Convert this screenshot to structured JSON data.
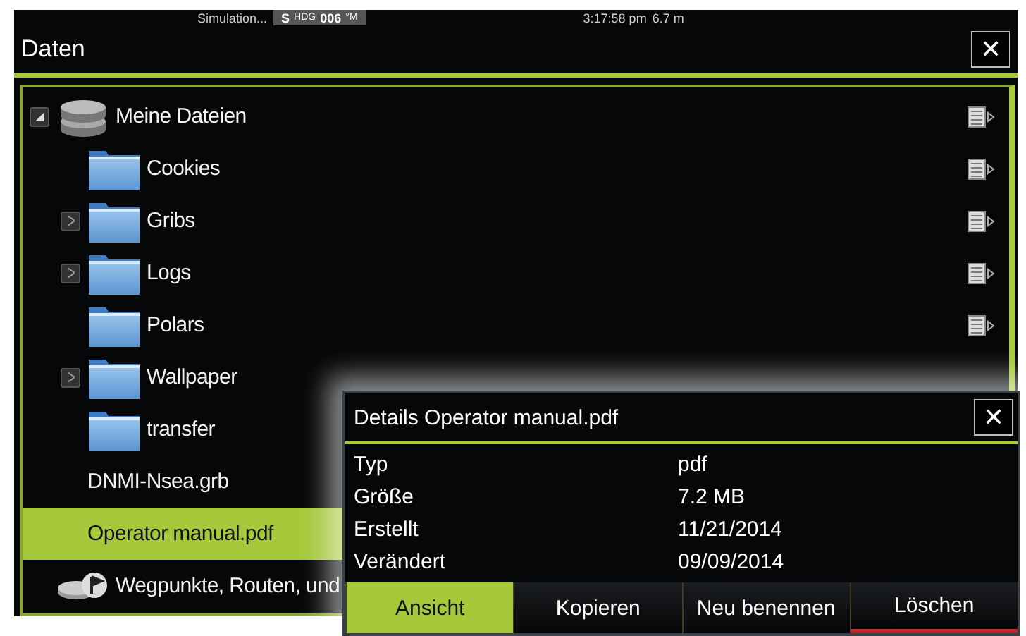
{
  "status_bar": {
    "source": "Simulation...",
    "heading": {
      "prefix": "S",
      "label": "HDG",
      "value": "006",
      "unit": "°M"
    },
    "time": "3:17:58 pm",
    "depth": "6.7 m"
  },
  "window": {
    "title": "Daten",
    "close": "✕"
  },
  "tree": [
    {
      "label": "Meine Dateien",
      "kind": "drive",
      "expanded": true,
      "selected": false,
      "menu_button": true,
      "children": [
        {
          "label": "Cookies",
          "kind": "folder",
          "selected": false,
          "menu_button": true
        },
        {
          "label": "Gribs",
          "kind": "folder",
          "expanded": false,
          "selected": false,
          "menu_button": true
        },
        {
          "label": "Logs",
          "kind": "folder",
          "expanded": false,
          "selected": false,
          "menu_button": true
        },
        {
          "label": "Polars",
          "kind": "folder",
          "selected": false,
          "menu_button": true
        },
        {
          "label": "Wallpaper",
          "kind": "folder",
          "expanded": false,
          "selected": false,
          "menu_button": false
        },
        {
          "label": "transfer",
          "kind": "folder",
          "selected": false,
          "menu_button": false
        },
        {
          "label": "DNMI-Nsea.grb",
          "kind": "file",
          "selected": false,
          "menu_button": false
        },
        {
          "label": "Operator manual.pdf",
          "kind": "file",
          "selected": true,
          "menu_button": false
        }
      ]
    },
    {
      "label": "Wegpunkte, Routen, und",
      "kind": "waypoints",
      "selected": false,
      "menu_button": false
    }
  ],
  "dialog": {
    "title": "Details Operator manual.pdf",
    "close": "✕",
    "rows": [
      {
        "label": "Typ",
        "value": "pdf"
      },
      {
        "label": "Größe",
        "value": "7.2 MB"
      },
      {
        "label": "Erstellt",
        "value": "11/21/2014"
      },
      {
        "label": "Verändert",
        "value": "09/09/2014"
      }
    ],
    "buttons": [
      {
        "label": "Ansicht",
        "selected": true,
        "kind": "normal"
      },
      {
        "label": "Kopieren",
        "selected": false,
        "kind": "normal"
      },
      {
        "label": "Neu benennen",
        "selected": false,
        "kind": "normal"
      },
      {
        "label": "Löschen",
        "selected": false,
        "kind": "destructive"
      }
    ]
  }
}
